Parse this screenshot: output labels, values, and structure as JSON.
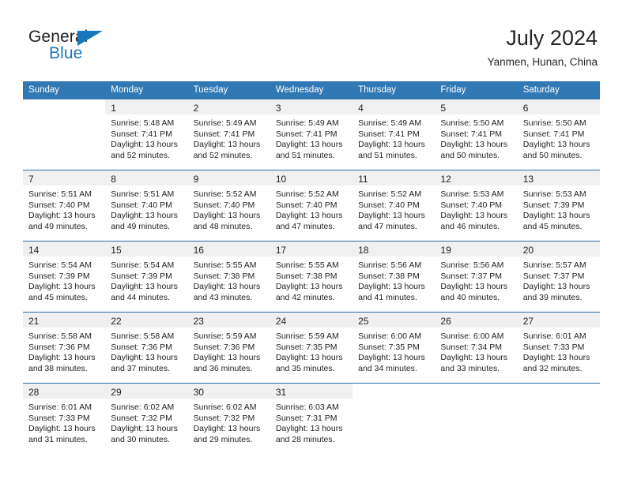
{
  "brand": {
    "name_part1": "General",
    "name_part2": "Blue",
    "accent_color": "#1878be",
    "triangle_icon": "triangle-icon"
  },
  "header": {
    "title": "July 2024",
    "subtitle": "Yanmen, Hunan, China"
  },
  "theme": {
    "header_blue": "#3179b5",
    "rule_blue": "#2e6da4",
    "daynum_band": "#f0f0f0",
    "text": "#231f20"
  },
  "calendar": {
    "weekday_headers": [
      "Sunday",
      "Monday",
      "Tuesday",
      "Wednesday",
      "Thursday",
      "Friday",
      "Saturday"
    ],
    "weeks": [
      [
        {
          "day": "",
          "sunrise": "",
          "sunset": "",
          "daylight_line1": "",
          "daylight_line2": ""
        },
        {
          "day": "1",
          "sunrise": "Sunrise: 5:48 AM",
          "sunset": "Sunset: 7:41 PM",
          "daylight_line1": "Daylight: 13 hours",
          "daylight_line2": "and 52 minutes."
        },
        {
          "day": "2",
          "sunrise": "Sunrise: 5:49 AM",
          "sunset": "Sunset: 7:41 PM",
          "daylight_line1": "Daylight: 13 hours",
          "daylight_line2": "and 52 minutes."
        },
        {
          "day": "3",
          "sunrise": "Sunrise: 5:49 AM",
          "sunset": "Sunset: 7:41 PM",
          "daylight_line1": "Daylight: 13 hours",
          "daylight_line2": "and 51 minutes."
        },
        {
          "day": "4",
          "sunrise": "Sunrise: 5:49 AM",
          "sunset": "Sunset: 7:41 PM",
          "daylight_line1": "Daylight: 13 hours",
          "daylight_line2": "and 51 minutes."
        },
        {
          "day": "5",
          "sunrise": "Sunrise: 5:50 AM",
          "sunset": "Sunset: 7:41 PM",
          "daylight_line1": "Daylight: 13 hours",
          "daylight_line2": "and 50 minutes."
        },
        {
          "day": "6",
          "sunrise": "Sunrise: 5:50 AM",
          "sunset": "Sunset: 7:41 PM",
          "daylight_line1": "Daylight: 13 hours",
          "daylight_line2": "and 50 minutes."
        }
      ],
      [
        {
          "day": "7",
          "sunrise": "Sunrise: 5:51 AM",
          "sunset": "Sunset: 7:40 PM",
          "daylight_line1": "Daylight: 13 hours",
          "daylight_line2": "and 49 minutes."
        },
        {
          "day": "8",
          "sunrise": "Sunrise: 5:51 AM",
          "sunset": "Sunset: 7:40 PM",
          "daylight_line1": "Daylight: 13 hours",
          "daylight_line2": "and 49 minutes."
        },
        {
          "day": "9",
          "sunrise": "Sunrise: 5:52 AM",
          "sunset": "Sunset: 7:40 PM",
          "daylight_line1": "Daylight: 13 hours",
          "daylight_line2": "and 48 minutes."
        },
        {
          "day": "10",
          "sunrise": "Sunrise: 5:52 AM",
          "sunset": "Sunset: 7:40 PM",
          "daylight_line1": "Daylight: 13 hours",
          "daylight_line2": "and 47 minutes."
        },
        {
          "day": "11",
          "sunrise": "Sunrise: 5:52 AM",
          "sunset": "Sunset: 7:40 PM",
          "daylight_line1": "Daylight: 13 hours",
          "daylight_line2": "and 47 minutes."
        },
        {
          "day": "12",
          "sunrise": "Sunrise: 5:53 AM",
          "sunset": "Sunset: 7:40 PM",
          "daylight_line1": "Daylight: 13 hours",
          "daylight_line2": "and 46 minutes."
        },
        {
          "day": "13",
          "sunrise": "Sunrise: 5:53 AM",
          "sunset": "Sunset: 7:39 PM",
          "daylight_line1": "Daylight: 13 hours",
          "daylight_line2": "and 45 minutes."
        }
      ],
      [
        {
          "day": "14",
          "sunrise": "Sunrise: 5:54 AM",
          "sunset": "Sunset: 7:39 PM",
          "daylight_line1": "Daylight: 13 hours",
          "daylight_line2": "and 45 minutes."
        },
        {
          "day": "15",
          "sunrise": "Sunrise: 5:54 AM",
          "sunset": "Sunset: 7:39 PM",
          "daylight_line1": "Daylight: 13 hours",
          "daylight_line2": "and 44 minutes."
        },
        {
          "day": "16",
          "sunrise": "Sunrise: 5:55 AM",
          "sunset": "Sunset: 7:38 PM",
          "daylight_line1": "Daylight: 13 hours",
          "daylight_line2": "and 43 minutes."
        },
        {
          "day": "17",
          "sunrise": "Sunrise: 5:55 AM",
          "sunset": "Sunset: 7:38 PM",
          "daylight_line1": "Daylight: 13 hours",
          "daylight_line2": "and 42 minutes."
        },
        {
          "day": "18",
          "sunrise": "Sunrise: 5:56 AM",
          "sunset": "Sunset: 7:38 PM",
          "daylight_line1": "Daylight: 13 hours",
          "daylight_line2": "and 41 minutes."
        },
        {
          "day": "19",
          "sunrise": "Sunrise: 5:56 AM",
          "sunset": "Sunset: 7:37 PM",
          "daylight_line1": "Daylight: 13 hours",
          "daylight_line2": "and 40 minutes."
        },
        {
          "day": "20",
          "sunrise": "Sunrise: 5:57 AM",
          "sunset": "Sunset: 7:37 PM",
          "daylight_line1": "Daylight: 13 hours",
          "daylight_line2": "and 39 minutes."
        }
      ],
      [
        {
          "day": "21",
          "sunrise": "Sunrise: 5:58 AM",
          "sunset": "Sunset: 7:36 PM",
          "daylight_line1": "Daylight: 13 hours",
          "daylight_line2": "and 38 minutes."
        },
        {
          "day": "22",
          "sunrise": "Sunrise: 5:58 AM",
          "sunset": "Sunset: 7:36 PM",
          "daylight_line1": "Daylight: 13 hours",
          "daylight_line2": "and 37 minutes."
        },
        {
          "day": "23",
          "sunrise": "Sunrise: 5:59 AM",
          "sunset": "Sunset: 7:36 PM",
          "daylight_line1": "Daylight: 13 hours",
          "daylight_line2": "and 36 minutes."
        },
        {
          "day": "24",
          "sunrise": "Sunrise: 5:59 AM",
          "sunset": "Sunset: 7:35 PM",
          "daylight_line1": "Daylight: 13 hours",
          "daylight_line2": "and 35 minutes."
        },
        {
          "day": "25",
          "sunrise": "Sunrise: 6:00 AM",
          "sunset": "Sunset: 7:35 PM",
          "daylight_line1": "Daylight: 13 hours",
          "daylight_line2": "and 34 minutes."
        },
        {
          "day": "26",
          "sunrise": "Sunrise: 6:00 AM",
          "sunset": "Sunset: 7:34 PM",
          "daylight_line1": "Daylight: 13 hours",
          "daylight_line2": "and 33 minutes."
        },
        {
          "day": "27",
          "sunrise": "Sunrise: 6:01 AM",
          "sunset": "Sunset: 7:33 PM",
          "daylight_line1": "Daylight: 13 hours",
          "daylight_line2": "and 32 minutes."
        }
      ],
      [
        {
          "day": "28",
          "sunrise": "Sunrise: 6:01 AM",
          "sunset": "Sunset: 7:33 PM",
          "daylight_line1": "Daylight: 13 hours",
          "daylight_line2": "and 31 minutes."
        },
        {
          "day": "29",
          "sunrise": "Sunrise: 6:02 AM",
          "sunset": "Sunset: 7:32 PM",
          "daylight_line1": "Daylight: 13 hours",
          "daylight_line2": "and 30 minutes."
        },
        {
          "day": "30",
          "sunrise": "Sunrise: 6:02 AM",
          "sunset": "Sunset: 7:32 PM",
          "daylight_line1": "Daylight: 13 hours",
          "daylight_line2": "and 29 minutes."
        },
        {
          "day": "31",
          "sunrise": "Sunrise: 6:03 AM",
          "sunset": "Sunset: 7:31 PM",
          "daylight_line1": "Daylight: 13 hours",
          "daylight_line2": "and 28 minutes."
        },
        {
          "day": "",
          "sunrise": "",
          "sunset": "",
          "daylight_line1": "",
          "daylight_line2": ""
        },
        {
          "day": "",
          "sunrise": "",
          "sunset": "",
          "daylight_line1": "",
          "daylight_line2": ""
        },
        {
          "day": "",
          "sunrise": "",
          "sunset": "",
          "daylight_line1": "",
          "daylight_line2": ""
        }
      ]
    ]
  }
}
